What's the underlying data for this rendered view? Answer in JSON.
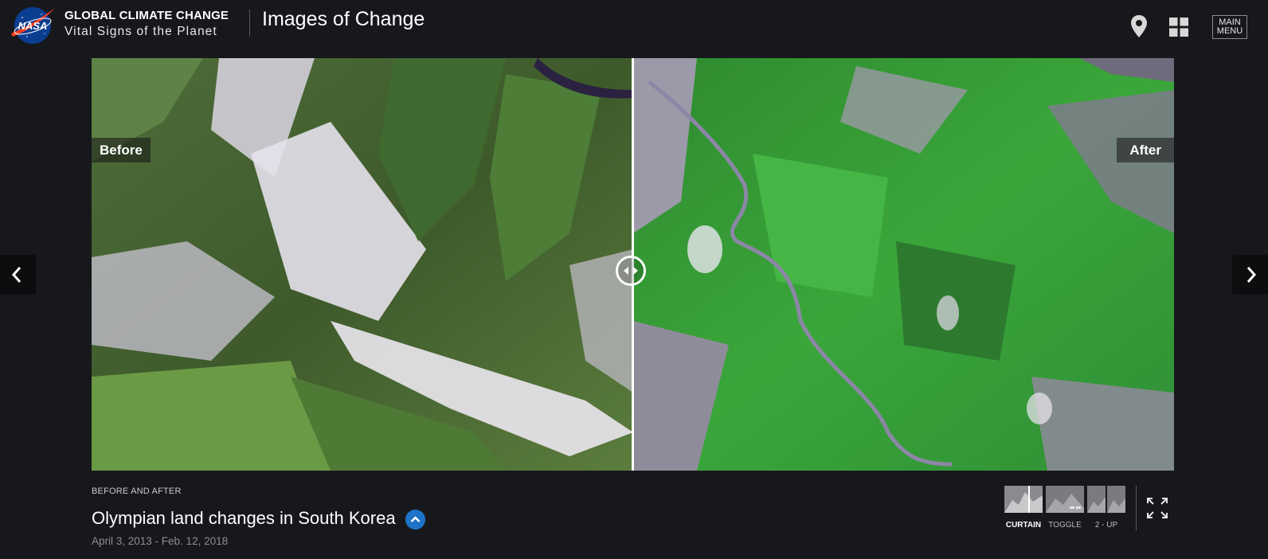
{
  "header": {
    "logo_label": "NASA",
    "site_title": "GLOBAL CLIMATE CHANGE",
    "site_subtitle": "Vital Signs of the Planet",
    "section_title": "Images of Change",
    "icons": [
      "location-pin-icon",
      "grid-icon"
    ],
    "menu_label_line1": "MAIN",
    "menu_label_line2": "MENU"
  },
  "slider": {
    "before_label": "Before",
    "after_label": "After",
    "position": 0.5
  },
  "caption": {
    "kicker": "BEFORE AND AFTER",
    "title": "Olympian land changes in South Korea",
    "date_range": "April 3, 2013 - Feb. 12, 2018"
  },
  "view_modes": {
    "items": [
      {
        "id": "curtain",
        "label": "CURTAIN",
        "active": true
      },
      {
        "id": "toggle",
        "label": "TOGGLE",
        "active": false
      },
      {
        "id": "2up",
        "label": "2 - UP",
        "active": false
      }
    ]
  },
  "colors": {
    "background": "#17181c",
    "accent_blue": "#1e73c8",
    "nasa_blue": "#0b3d91",
    "nasa_red": "#fc3d21"
  }
}
